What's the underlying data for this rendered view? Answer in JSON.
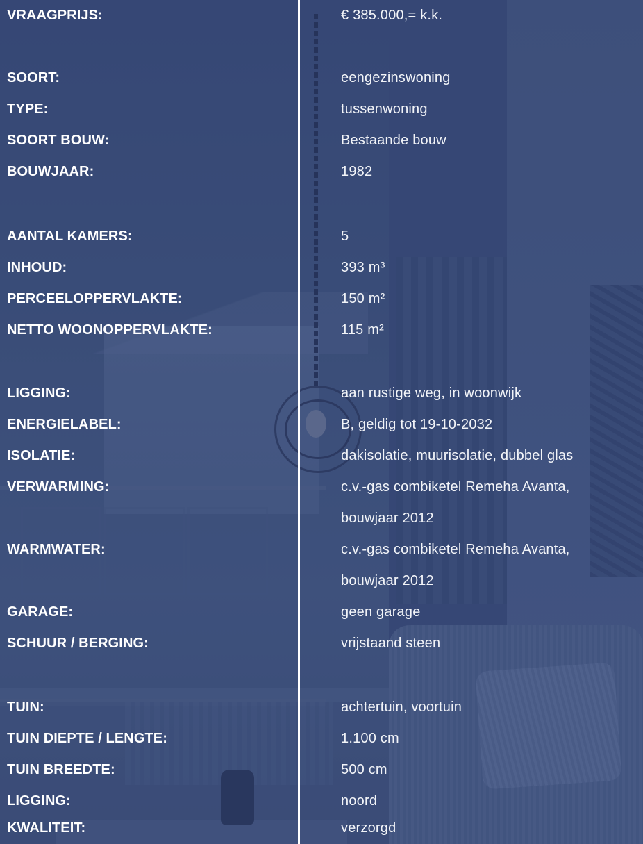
{
  "specs": [
    {
      "label": "VRAAGPRIJS:",
      "value": "€ 385.000,= k.k."
    },
    {
      "label": "SOORT:",
      "value": "eengezinswoning"
    },
    {
      "label": "TYPE:",
      "value": "tussenwoning"
    },
    {
      "label": "SOORT BOUW:",
      "value": "Bestaande bouw"
    },
    {
      "label": "BOUWJAAR:",
      "value": "1982"
    },
    {
      "label": "AANTAL KAMERS:",
      "value": "5"
    },
    {
      "label": "INHOUD:",
      "value": "393 m³"
    },
    {
      "label": "PERCEELOPPERVLAKTE:",
      "value": "150 m²"
    },
    {
      "label": "NETTO WOONOPPERVLAKTE:",
      "value": "115 m²"
    },
    {
      "label": "LIGGING:",
      "value": "aan rustige weg, in woonwijk"
    },
    {
      "label": "ENERGIELABEL:",
      "value": "B, geldig tot 19-10-2032"
    },
    {
      "label": "ISOLATIE:",
      "value": "dakisolatie, muurisolatie, dubbel glas"
    },
    {
      "label": "VERWARMING:",
      "value": "c.v.-gas combiketel Remeha Avanta,",
      "value2": "bouwjaar 2012"
    },
    {
      "label": "WARMWATER:",
      "value": "c.v.-gas combiketel Remeha Avanta,",
      "value2": "bouwjaar 2012"
    },
    {
      "label": "GARAGE:",
      "value": "geen garage"
    },
    {
      "label": "SCHUUR / BERGING:",
      "value": "vrijstaand steen"
    },
    {
      "label": "TUIN:",
      "value": "achtertuin, voortuin"
    },
    {
      "label": "TUIN DIEPTE / LENGTE:",
      "value": "1.100 cm"
    },
    {
      "label": "TUIN BREEDTE:",
      "value": "500 cm"
    },
    {
      "label": "LIGGING:",
      "value": "noord"
    },
    {
      "label": "KWALITEIT:",
      "value": "verzorgd"
    }
  ]
}
